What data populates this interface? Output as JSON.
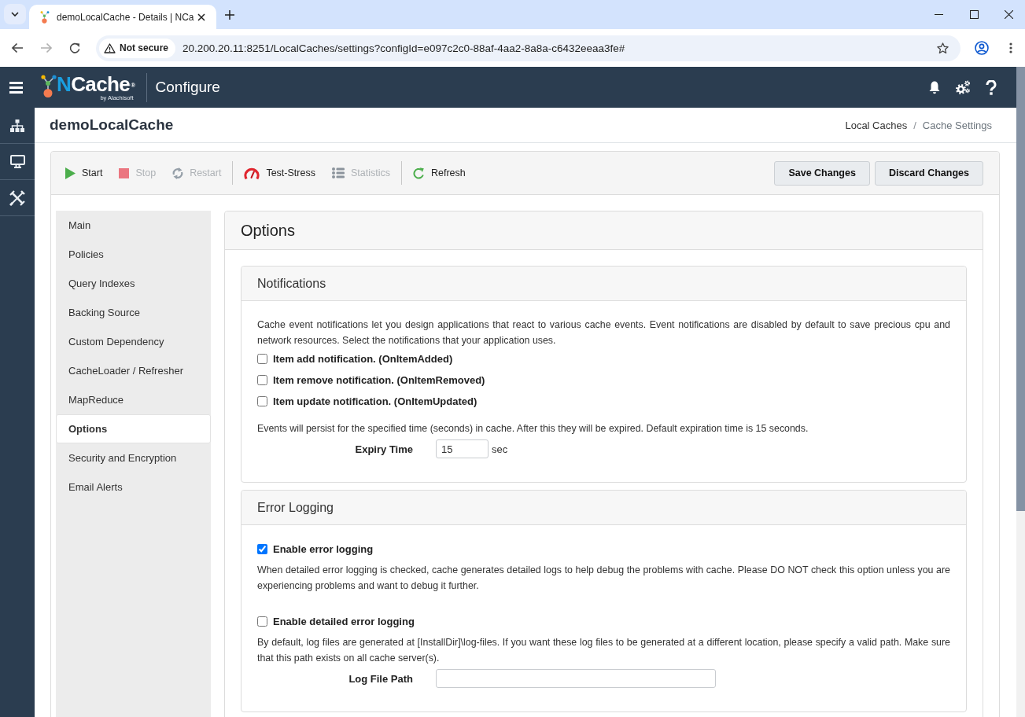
{
  "browser": {
    "tabs": [
      {
        "title": "demoLocalCache - Details | NCa",
        "selected": true
      }
    ],
    "navigation": {
      "back_disabled": false,
      "forward_disabled": true
    },
    "address_bar": {
      "security_chip": "Not secure",
      "url": "20.200.20.11:8251/LocalCaches/settings?configId=e097c2c0-88af-4aa2-8a8a-c6432eeaa3fe#"
    }
  },
  "app_header": {
    "logo": {
      "wordmark": "NCache$^{®}$",
      "byline": "by Alachisoft"
    },
    "section_title": "Configure"
  },
  "page_header": {
    "title": "demoLocalCache",
    "breadcrumb": {
      "separator": "/",
      "items": [
        {
          "label": "Local Caches",
          "current": false
        },
        {
          "label": "Cache Settings",
          "current": true
        }
      ]
    }
  },
  "toolbar": {
    "groups": [
      {
        "actions": [
          {
            "kind": "start",
            "label": "Start",
            "disabled": false
          },
          {
            "kind": "stop",
            "label": "Stop",
            "disabled": true
          },
          {
            "kind": "restart",
            "label": "Restart",
            "disabled": true
          }
        ]
      },
      {
        "actions": [
          {
            "kind": "test-stress",
            "label": "Test-Stress",
            "disabled": false
          },
          {
            "kind": "statistics",
            "label": "Statistics",
            "disabled": true
          }
        ]
      },
      {
        "actions": [
          {
            "kind": "refresh",
            "label": "Refresh",
            "disabled": false
          }
        ]
      }
    ],
    "buttons": [
      "Save Changes",
      "Discard Changes"
    ]
  },
  "settings_nav": {
    "items": [
      {
        "label": "Main",
        "selected": false
      },
      {
        "label": "Policies",
        "selected": false
      },
      {
        "label": "Query Indexes",
        "selected": false
      },
      {
        "label": "Backing Source",
        "selected": false
      },
      {
        "label": "Custom Dependency",
        "selected": false
      },
      {
        "label": "CacheLoader / Refresher",
        "selected": false
      },
      {
        "label": "MapReduce",
        "selected": false
      },
      {
        "label": "Options",
        "selected": true
      },
      {
        "label": "Security and Encryption",
        "selected": false
      },
      {
        "label": "Email Alerts",
        "selected": false
      }
    ]
  },
  "panel": {
    "title": "Options",
    "sections": [
      {
        "title": "Notifications",
        "items": [
          {
            "kind": "text",
            "text": "Cache event notifications let you design applications that react to various cache events. Event notifications are disabled by default to save precious cpu and network resources. Select the notifications that your application uses."
          },
          {
            "kind": "checkbox",
            "label": "Item add notification. (OnItemAdded)",
            "checked": false
          },
          {
            "kind": "checkbox",
            "label": "Item remove notification. (OnItemRemoved)",
            "checked": false
          },
          {
            "kind": "checkbox",
            "label": "Item update notification. (OnItemUpdated)",
            "checked": false
          },
          {
            "kind": "text",
            "text": "Events will persist for the specified time (seconds) in cache. After this they will be expired. Default expiration time is 15 seconds."
          },
          {
            "kind": "number_field",
            "label": "Expiry Time",
            "value": "15",
            "unit": "sec"
          }
        ]
      },
      {
        "title": "Error Logging",
        "items": [
          {
            "kind": "checkbox",
            "label": "Enable error logging",
            "checked": true
          },
          {
            "kind": "text",
            "text": "When detailed error logging is checked, cache generates detailed logs to help debug the problems with cache. Please DO NOT check this option unless you are experiencing problems and want to debug it further."
          },
          {
            "kind": "checkbox",
            "label": "Enable detailed error logging",
            "checked": false
          },
          {
            "kind": "text",
            "text": "By default, log files are generated at [InstallDir]\\log-files. If you want these log files to be generated at a different location, please specify a valid path. Make sure that this path exists on all cache server(s)."
          },
          {
            "kind": "text_field",
            "label": "Log File Path"
          }
        ]
      }
    ]
  }
}
